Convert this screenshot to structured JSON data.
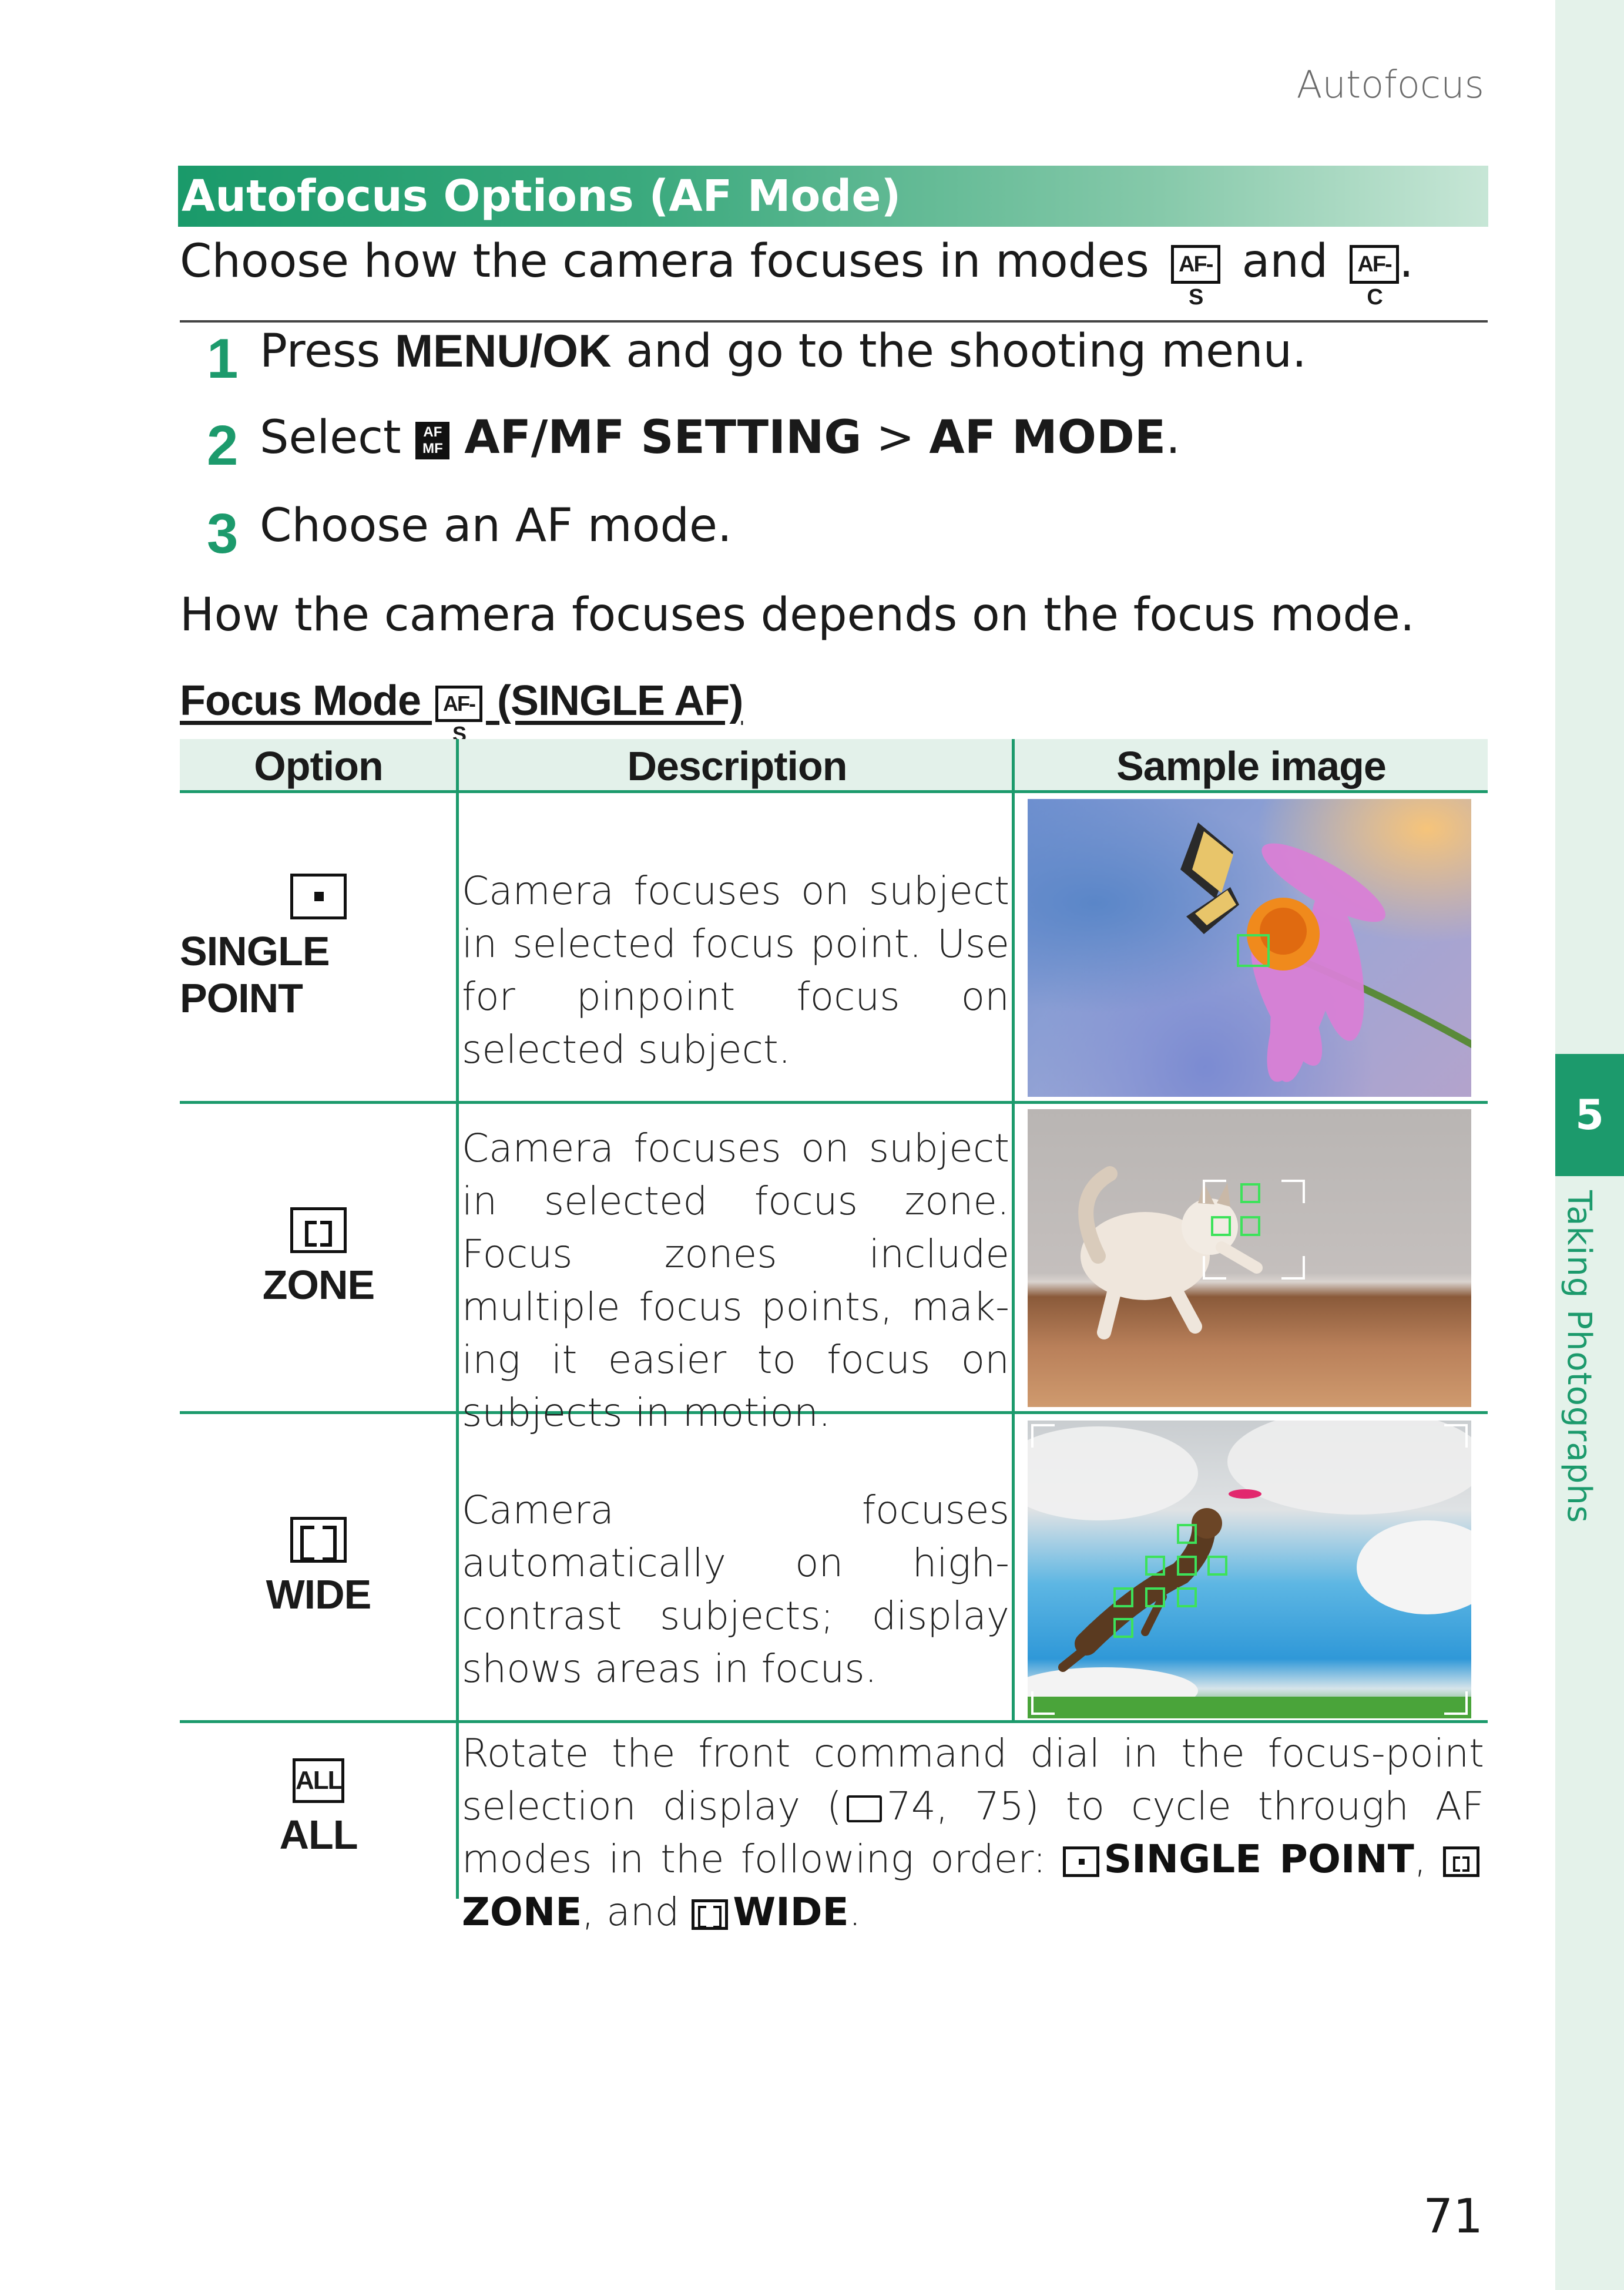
{
  "running_head": "Autofocus",
  "chapter": {
    "number": "5",
    "title": "Taking Photographs"
  },
  "section_title": "Autofocus Options (AF Mode)",
  "intro": {
    "before": "Choose how the camera focuses in modes",
    "icon1": "AF-S",
    "and": "and",
    "icon2": "AF-C",
    "after": "."
  },
  "steps": [
    {
      "num": "1",
      "pre": "Press ",
      "bold": "MENU/OK",
      "post": " and go to the shooting menu."
    },
    {
      "num": "2",
      "pre": "Select ",
      "icon": "AF/MF",
      "bold1": "AF/MF SETTING",
      "sep": " > ",
      "bold2": "AF MODE",
      "post": "."
    },
    {
      "num": "3",
      "text": "Choose an AF mode."
    }
  ],
  "depends_text": "How the camera focuses depends on the focus mode.",
  "table_title": {
    "pre": "Focus Mode",
    "icon": "AF-S",
    "post": "(SINGLE AF)"
  },
  "table": {
    "headers": {
      "option": "Option",
      "description": "Description",
      "sample": "Sample image"
    },
    "rows": [
      {
        "option": "SINGLE POINT",
        "icon": "single-point-icon",
        "description": "Camera focuses on subject in selected focus point. Use for pin­point focus on selected subject."
      },
      {
        "option": "ZONE",
        "icon": "zone-icon",
        "description": "Camera focuses on subject in se­lected focus zone. Focus zones in­clude multiple focus points, mak­ing it easier to focus on subjects in motion."
      },
      {
        "option": "WIDE",
        "icon": "wide-icon",
        "description": "Camera focuses automatically on high-contrast subjects; display shows areas in focus."
      },
      {
        "option": "ALL",
        "icon": "all-icon",
        "icon_text": "ALL",
        "description": {
          "pre": "Rotate the front command dial in the focus-point selection dis­play (",
          "ref": "74, 75",
          "mid": ") to cycle through AF modes in the following order: ",
          "m1": "SINGLE POINT",
          "c1": ", ",
          "m2": "ZONE",
          "c2": ", and ",
          "m3": "WIDE",
          "end": "."
        }
      }
    ]
  },
  "page_number": "71"
}
